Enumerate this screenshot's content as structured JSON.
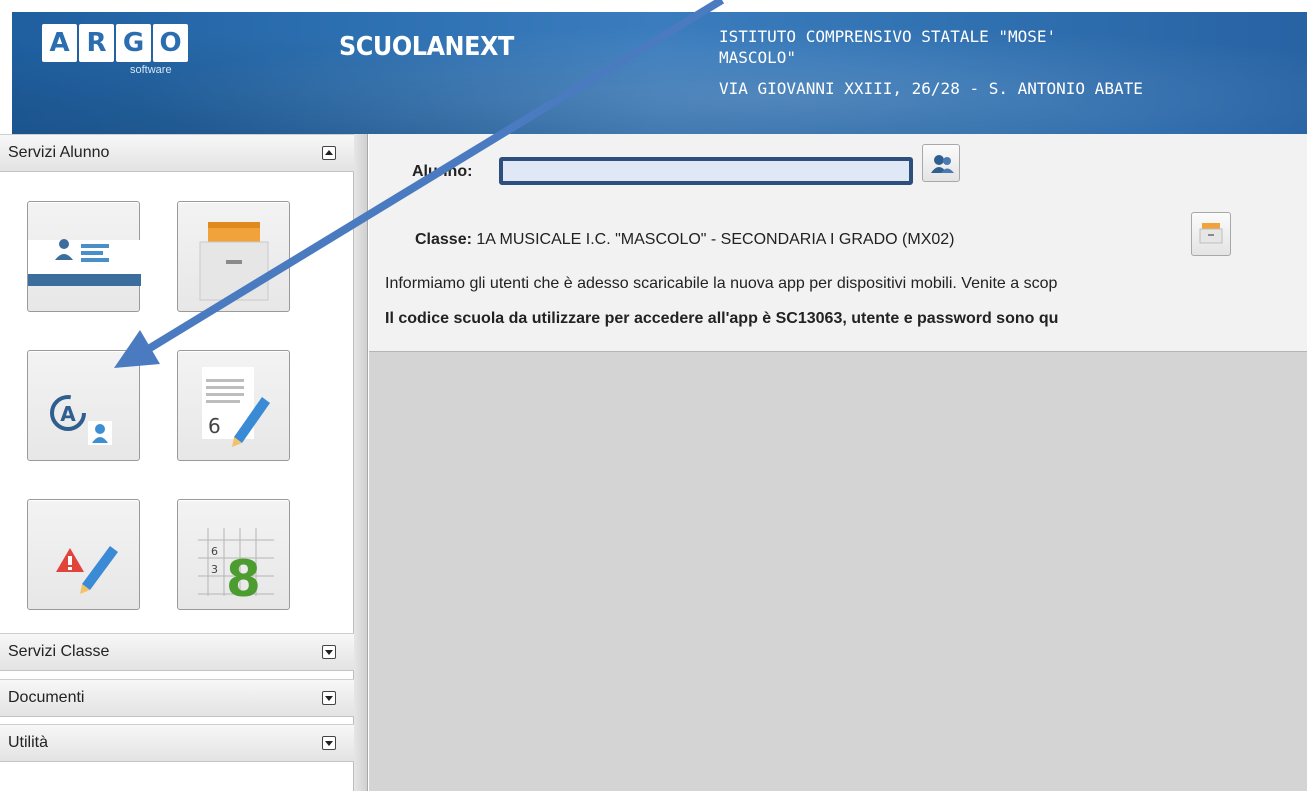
{
  "header": {
    "logo_letters": [
      "A",
      "R",
      "G",
      "O"
    ],
    "logo_sub": "software",
    "app_title": "SCUOLANEXT",
    "school_name_line1": "ISTITUTO COMPRENSIVO STATALE \"MOSE'",
    "school_name_line2": "MASCOLO\"",
    "school_address": "VIA GIOVANNI XXIII, 26/28 - S. ANTONIO ABATE",
    "colors": {
      "banner": "#2c6fb0",
      "text": "#ffffff"
    }
  },
  "sidebar": {
    "sections": [
      {
        "label": "Servizi Alunno",
        "state": "expanded"
      },
      {
        "label": "Servizi Classe",
        "state": "collapsed"
      },
      {
        "label": "Documenti",
        "state": "collapsed"
      },
      {
        "label": "Utilità",
        "state": "collapsed"
      }
    ],
    "tiles": [
      {
        "icon": "student-card-icon"
      },
      {
        "icon": "archive-drawer-icon"
      },
      {
        "icon": "absences-icon"
      },
      {
        "icon": "grades-pencil-icon"
      },
      {
        "icon": "notes-alert-icon"
      },
      {
        "icon": "grade-grid-icon"
      }
    ],
    "tile_numbers": {
      "grades": "6",
      "grid_small_a": "6",
      "grid_small_b": "3",
      "grid_big": "8"
    },
    "tile_letter": "A"
  },
  "main": {
    "alunno_label": "Alunno:",
    "alunno_value": "",
    "classe_label": "Classe:",
    "classe_value": "1A MUSICALE I.C. \"MASCOLO\" - SECONDARIA I GRADO (MX02)",
    "message_line1": "Informiamo gli utenti che è adesso scaricabile la nuova app per dispositivi mobili. Venite a scop",
    "message_line2": "Il codice scuola da utilizzare per accedere all'app è SC13063, utente e password sono qu",
    "select_student_icon": "users-icon",
    "select_class_icon": "archive-icon"
  },
  "annotation": {
    "color": "#4a7bc0",
    "type": "arrow"
  }
}
